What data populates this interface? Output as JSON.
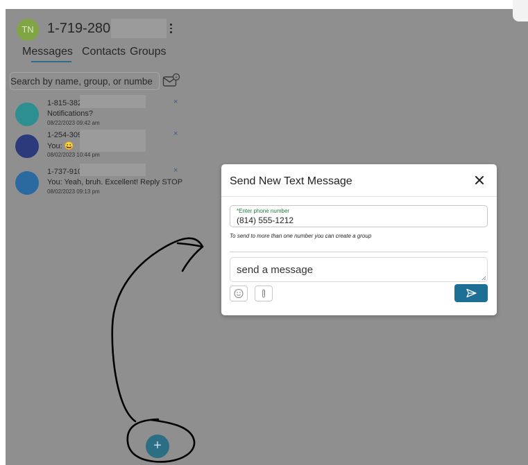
{
  "header": {
    "avatar_initials": "TN",
    "phone": "1-719-280-00",
    "menu_icon": "kebab-menu-icon"
  },
  "tabs": [
    {
      "label": "Messages",
      "active": true
    },
    {
      "label": "Contacts",
      "active": false
    },
    {
      "label": "Groups",
      "active": false
    }
  ],
  "search": {
    "placeholder": "Search by name, group, or numbe",
    "value": ""
  },
  "conversations": [
    {
      "number": "1-815-382-3",
      "snippet": "Notifications?",
      "date": "08/22/2023 09:42 am",
      "color": "#2d8f8f"
    },
    {
      "number": "1-254-309-1",
      "snippet": "You: 😀",
      "date": "08/02/2023 10:44 pm",
      "color": "#2a3a7a"
    },
    {
      "number": "1-737-910-3",
      "snippet": "You: Yeah, bruh. Excellent! Reply STOP",
      "date": "08/02/2023 09:13 pm",
      "color": "#2a6aa0"
    }
  ],
  "fab_label": "+",
  "modal": {
    "title": "Send New Text Message",
    "phone_label": "*Enter phone number",
    "phone_value": "(814) 555-1212",
    "hint": "To send to more than one number you can create a group",
    "message_placeholder": "send a message",
    "message_value": ""
  },
  "colors": {
    "backdrop": "#8f8f8f",
    "accent": "#1e6f96",
    "avatar": "#7fa544",
    "label_green": "#1f7a3d"
  }
}
